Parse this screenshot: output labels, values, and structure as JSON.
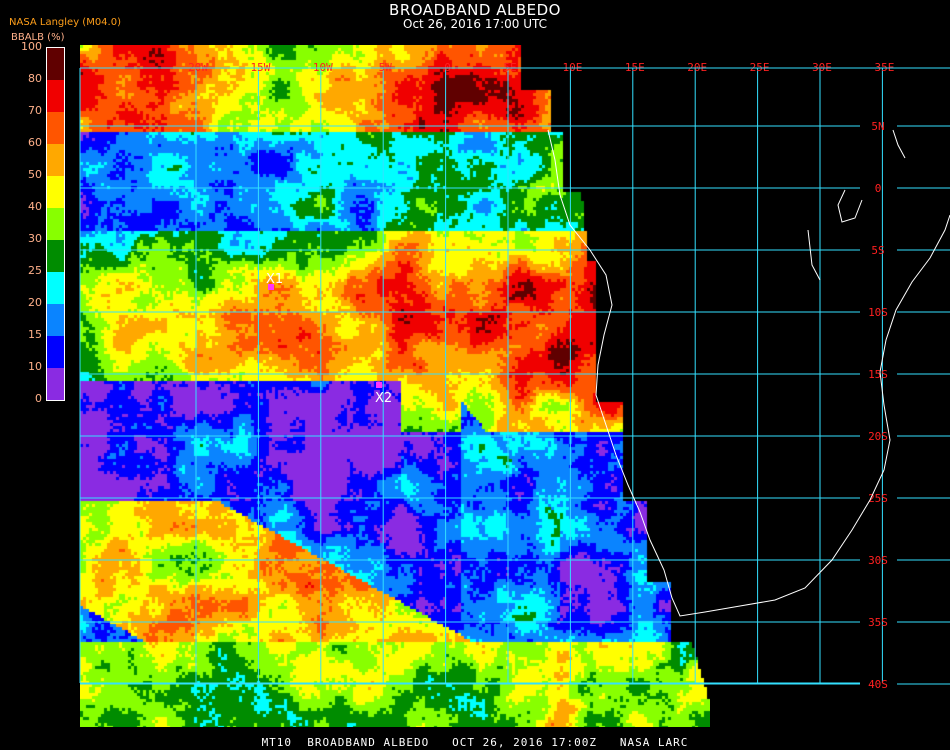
{
  "header": {
    "title": "BROADBAND ALBEDO",
    "subtitle": "Oct 26, 2016 17:00 UTC",
    "agency": "NASA Langley (M04.0)"
  },
  "colorbar": {
    "label": "BBALB (%)",
    "ticks": [
      "0",
      "10",
      "15",
      "20",
      "25",
      "30",
      "40",
      "50",
      "60",
      "70",
      "80",
      "100"
    ],
    "colors": [
      "#8a2be2",
      "#0000ff",
      "#0a84ff",
      "#00ffff",
      "#008c00",
      "#88ff00",
      "#ffff00",
      "#ffa800",
      "#ff5500",
      "#f00000",
      "#600000"
    ]
  },
  "grid": {
    "lon_labels": [
      "20W",
      "15W",
      "10W",
      "5W",
      "0",
      "5E",
      "10E",
      "15E",
      "20E",
      "25E",
      "30E",
      "35E"
    ],
    "lat_labels": [
      "5N",
      "0",
      "5S",
      "10S",
      "15S",
      "20S",
      "25S",
      "30S",
      "35S",
      "40S"
    ],
    "grid_color": "#33e0ff",
    "label_color": "#ff2020"
  },
  "markers": [
    {
      "label": "X1"
    },
    {
      "label": "X2"
    }
  ],
  "footer": "MT10  BROADBAND ALBEDO   OCT 26, 2016 17:00Z   NASA LARC"
}
